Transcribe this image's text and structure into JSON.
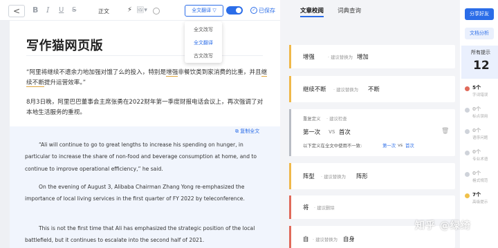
{
  "toolbar": {
    "back": "<",
    "bold": "B",
    "italic": "I",
    "underline": "U",
    "strike": "S",
    "para": "正文",
    "magic": "⚡",
    "image": "🖼▾",
    "mode": "全文翻译 ▽",
    "saved": "已保存"
  },
  "dropdown": [
    "全文改写",
    "全文翻译",
    "古文改写"
  ],
  "editor": {
    "title": "写作猫网页版",
    "p1_a": "“阿里将继续不遗余力地加强对饿了么的投入，特别是",
    "p1_hl1": "增强",
    "p1_b": "非餐饮类到家消费的比重，并且",
    "p1_hl2": "继续不断",
    "p1_c": "提升运营效率。”",
    "p2": "8月3日晚，阿里巴巴董事会主席张勇在2022财年第一季度财报电话会议上，再次强调了对本地生活服务的重视。",
    "copy_all": "复制全文",
    "en1": "“Ali will continue to go to great lengths to increase his spending on hunger, in particular to increase the share of non-food and beverage consumption at home, and to continue to improve operational efficiency,” he said.",
    "en2": "On the evening of August 3, Alibaba Chairman Zhang Yong re-emphasized the importance of local living services in the first quarter of FY 2022 by teleconference.",
    "en3": "This is not the first time that Ali has emphasized the strategic position of the local battlefield, but it continues to escalate into the second half of 2021."
  },
  "tabs": [
    "文章校阅",
    "词典查询"
  ],
  "cards": {
    "c1": {
      "word": "增强",
      "hint": "· 建议替换为",
      "rep": "增加"
    },
    "c2": {
      "word": "继续不断",
      "hint": "· 建议替换为",
      "rep": "不断"
    },
    "c3": {
      "head": "重复定义",
      "hint": "· 建议检查",
      "w1": "第一次",
      "vs": "vs",
      "w2": "首次",
      "note": "以下定义在全文中使用不一致:",
      "nw1": "第一次",
      "nvs": "vs",
      "nw2": "首次"
    },
    "c4": {
      "word": "阵型",
      "hint": "· 建议替换为",
      "rep": "阵形"
    },
    "c5": {
      "word": "将",
      "hint": "· 建议删除"
    },
    "c6": {
      "word": "自",
      "hint": "· 建议替换为",
      "rep": "自身"
    }
  },
  "sidebar": {
    "share": "分享好友",
    "analysis": "文档分析",
    "all_label": "所有提示",
    "all_count": "12",
    "cats": [
      {
        "count": "5个",
        "label": "字词错误",
        "color": "#e06a5a"
      },
      {
        "count": "0个",
        "label": "标点误用",
        "color": "#cfd3da"
      },
      {
        "count": "0个",
        "label": "语序问题",
        "color": "#cfd3da"
      },
      {
        "count": "0个",
        "label": "专业术语",
        "color": "#cfd3da"
      },
      {
        "count": "0个",
        "label": "格式规范",
        "color": "#cfd3da"
      },
      {
        "count": "7个",
        "label": "高级提示",
        "color": "#f0c14a"
      }
    ]
  },
  "watermark": "知乎 @绿绮"
}
